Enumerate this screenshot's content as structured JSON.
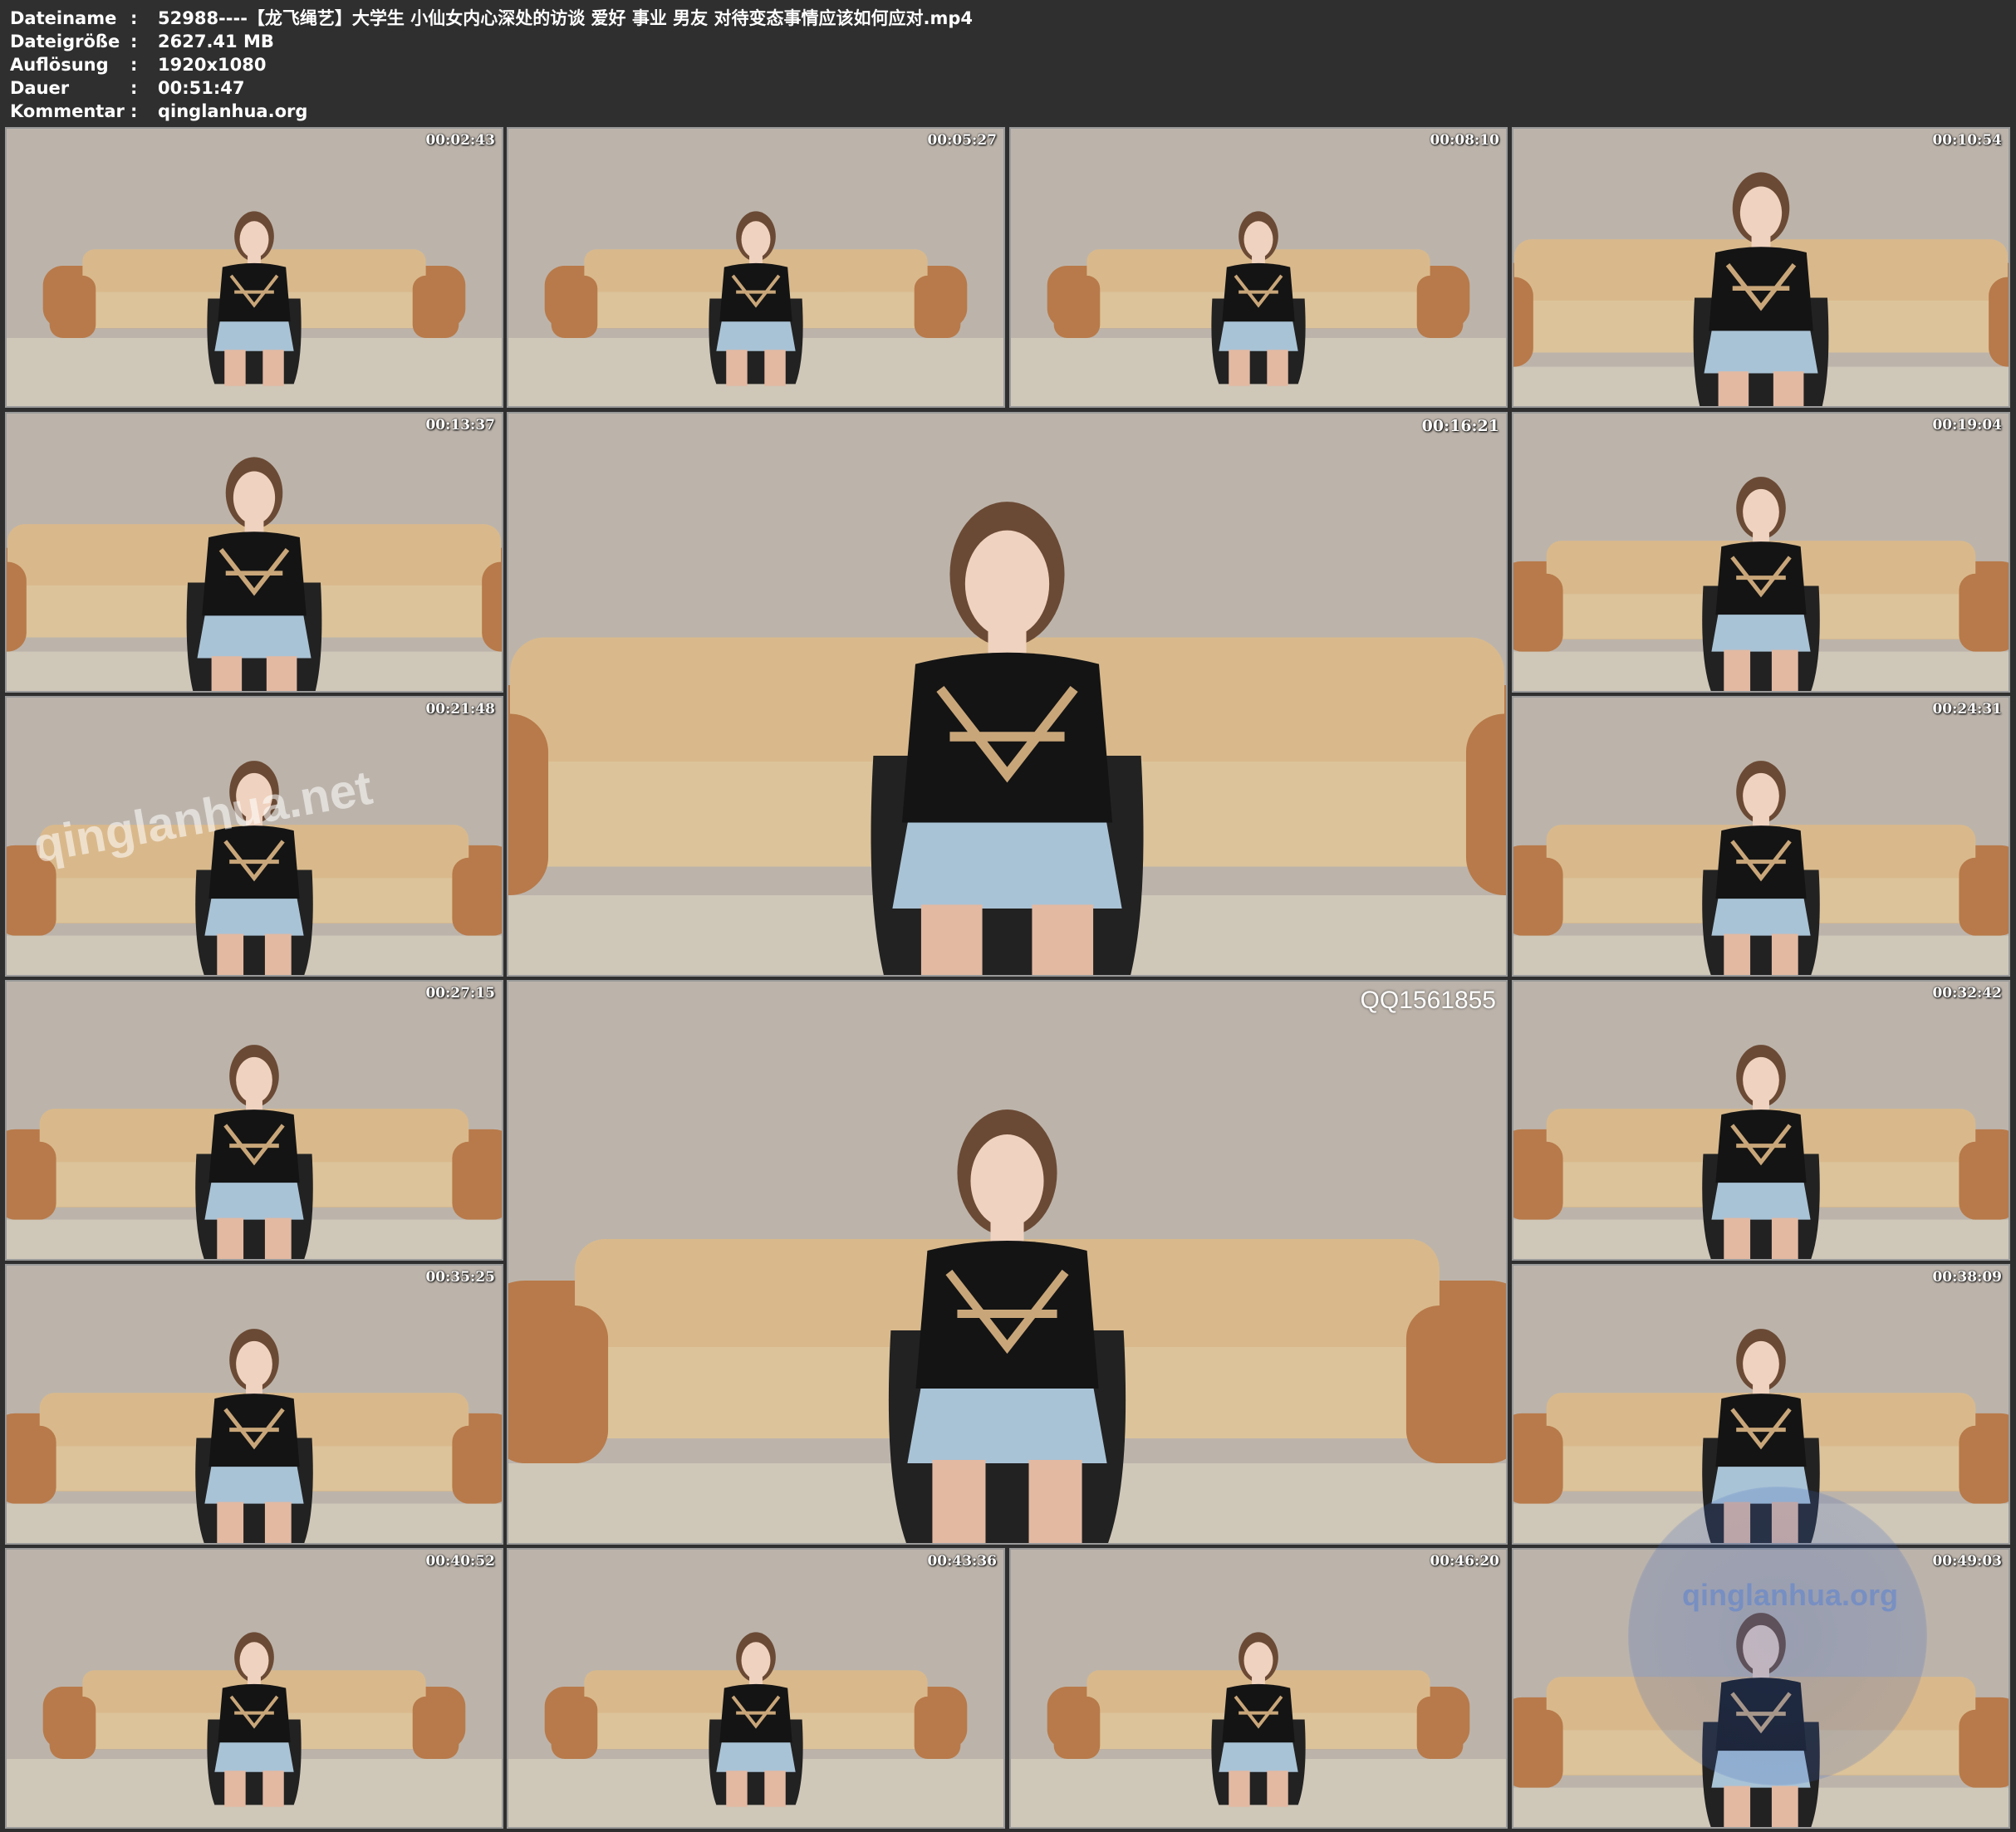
{
  "header": {
    "rows": [
      {
        "key": "Dateiname",
        "colon": ":",
        "value": "52988----【龙飞绳艺】大学生 小仙女内心深处的访谈 爱好 事业 男友 对待变态事情应该如何应对.mp4"
      },
      {
        "key": "Dateigröße",
        "colon": ":",
        "value": "2627.41 MB"
      },
      {
        "key": "Auflösung",
        "colon": ":",
        "value": "1920x1080"
      },
      {
        "key": "Dauer",
        "colon": ":",
        "value": "00:51:47"
      },
      {
        "key": "Kommentar",
        "colon": ":",
        "value": "qinglanhua.org"
      }
    ]
  },
  "thumbnails": [
    {
      "timestamp": "00:02:43"
    },
    {
      "timestamp": "00:05:27"
    },
    {
      "timestamp": "00:08:10"
    },
    {
      "timestamp": "00:10:54"
    },
    {
      "timestamp": "00:13:37"
    },
    {
      "timestamp": "00:16:21"
    },
    {
      "timestamp": "00:19:04"
    },
    {
      "timestamp": "00:21:48"
    },
    {
      "timestamp": "00:24:31"
    },
    {
      "timestamp": "00:27:15"
    },
    {
      "timestamp": "00:32:42"
    },
    {
      "timestamp": "00:35:25"
    },
    {
      "timestamp": "00:38:09"
    },
    {
      "timestamp": "00:40:52"
    },
    {
      "timestamp": "00:43:36"
    },
    {
      "timestamp": "00:46:20"
    },
    {
      "timestamp": "00:49:03"
    }
  ],
  "watermarks": {
    "thumb_overlay": "qinglanhua.net",
    "qq": "QQ1561855",
    "circle": "qinglanhua.org"
  },
  "colors": {
    "background": "#2f2f2f",
    "wall": "#bcb4ab",
    "sofa": "#d9b98c",
    "sofa_frame": "#b87a4a",
    "top": "#141414",
    "skirt": "#a9c3d6",
    "floor": "#cfc7b8"
  }
}
